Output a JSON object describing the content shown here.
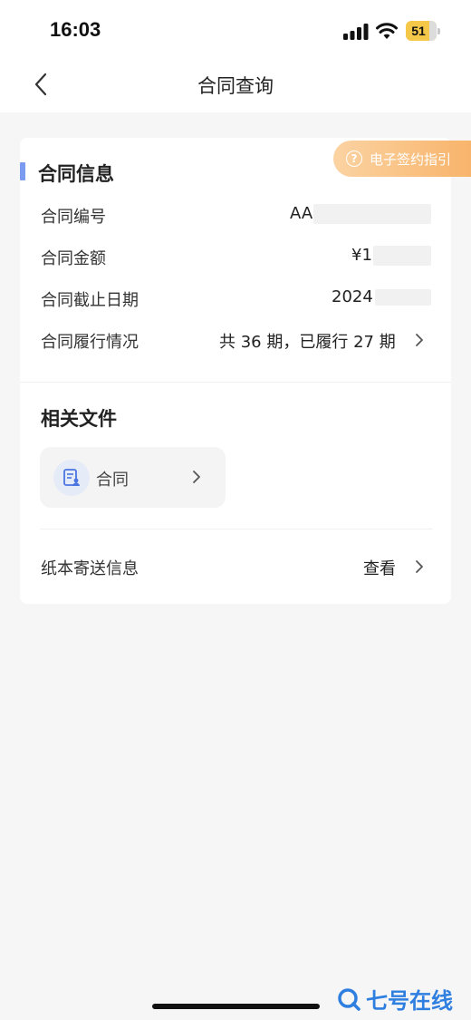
{
  "status_bar": {
    "time": "16:03",
    "battery": "51"
  },
  "nav": {
    "title": "合同查询"
  },
  "guide": {
    "label": "电子签约指引",
    "icon": "question-circle-icon"
  },
  "contract_info": {
    "title": "合同信息",
    "rows": [
      {
        "label": "合同编号",
        "value": "AA"
      },
      {
        "label": "合同金额",
        "value": "¥1,"
      },
      {
        "label": "合同截止日期",
        "value": "2024"
      },
      {
        "label": "合同履行情况",
        "value": "共 36 期，已履行 27 期"
      }
    ]
  },
  "files": {
    "title": "相关文件",
    "items": [
      {
        "label": "合同",
        "icon": "contract-document-icon"
      }
    ]
  },
  "delivery": {
    "label": "纸本寄送信息",
    "action": "查看"
  },
  "watermark": {
    "text": "七号在线"
  },
  "colors": {
    "accent_blue": "#7b9bf0",
    "guide_orange": "#f8b46b",
    "battery_yellow": "#f5c84a",
    "watermark_blue": "#2f7fe0"
  }
}
